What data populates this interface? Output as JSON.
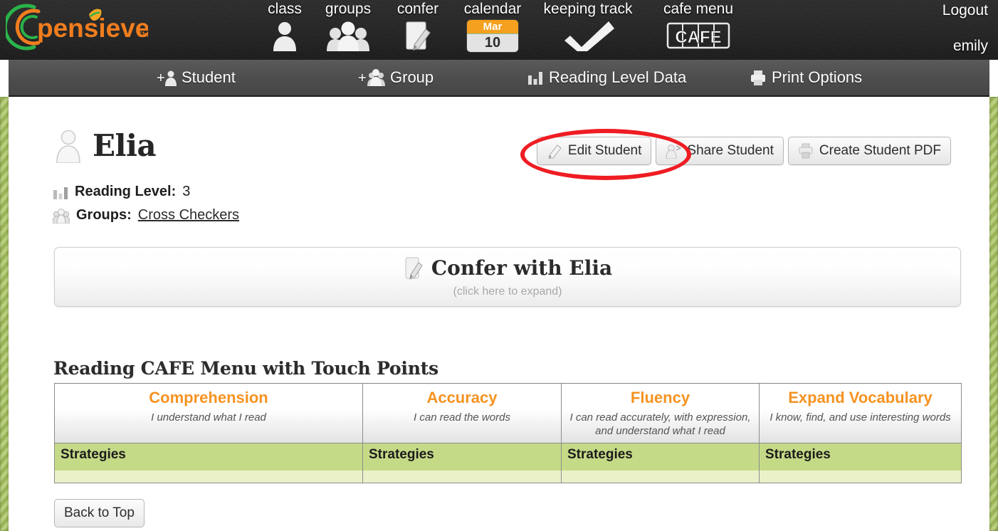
{
  "header": {
    "logo_text": "pensieve",
    "logo_tm": "TM",
    "nav": [
      {
        "label": "class",
        "icon": "person-icon"
      },
      {
        "label": "groups",
        "icon": "people-icon"
      },
      {
        "label": "confer",
        "icon": "note-pencil-icon"
      },
      {
        "label": "calendar",
        "icon": "calendar-icon",
        "month": "Mar",
        "day": "10"
      },
      {
        "label": "keeping track",
        "icon": "checkmark-icon"
      },
      {
        "label": "cafe menu",
        "icon": "cafe-icon",
        "icon_text": "CAFE"
      }
    ],
    "logout_label": "Logout",
    "username": "emily"
  },
  "subnav": [
    {
      "label": "Student",
      "icon": "add-person-icon"
    },
    {
      "label": "Group",
      "icon": "add-people-icon"
    },
    {
      "label": "Reading Level Data",
      "icon": "bar-chart-icon"
    },
    {
      "label": "Print Options",
      "icon": "printer-icon"
    }
  ],
  "student": {
    "name": "Elia",
    "avatar_icon": "person-outline-icon",
    "reading_level_label": "Reading Level:",
    "reading_level_value": "3",
    "reading_level_icon": "bar-chart-icon",
    "groups_label": "Groups:",
    "groups_value": "Cross Checkers",
    "groups_icon": "people-icon"
  },
  "actions": [
    {
      "label": "Edit Student",
      "icon": "pencil-icon",
      "highlighted": true
    },
    {
      "label": "Share Student",
      "icon": "share-person-icon",
      "highlighted": false
    },
    {
      "label": "Create Student PDF",
      "icon": "printer-icon",
      "highlighted": false
    }
  ],
  "annotation": {
    "shape": "ellipse",
    "color": "#ee1d23",
    "targets": "Edit Student"
  },
  "confer": {
    "title": "Confer with Elia",
    "subtitle": "(click here to expand)",
    "icon": "note-pencil-icon"
  },
  "cafe": {
    "heading": "Reading CAFE Menu with Touch Points",
    "columns": [
      {
        "title": "Comprehension",
        "desc": "I understand what I read"
      },
      {
        "title": "Accuracy",
        "desc": "I can read the words"
      },
      {
        "title": "Fluency",
        "desc": "I can read accurately, with expression, and understand what I read"
      },
      {
        "title": "Expand Vocabulary",
        "desc": "I know, find, and use interesting words"
      }
    ],
    "strategies_label": "Strategies",
    "accent_color": "#f59322",
    "strategies_bg": "#c5da87"
  },
  "footer": {
    "back_to_top": "Back to Top"
  }
}
